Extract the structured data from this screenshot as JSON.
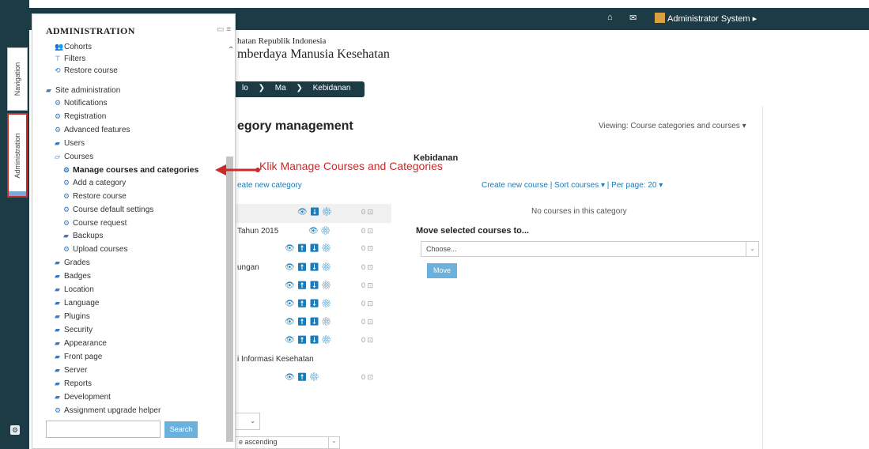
{
  "topbar": {
    "home_icon": "house-icon",
    "mail_icon": "message-icon",
    "user_name": "Administrator System ▸"
  },
  "dock": {
    "nav_label": "Navigation",
    "admin_label": "Administration"
  },
  "brand": {
    "line1": "hatan Republik Indonesia",
    "line2": "mberdaya Manusia Kesehatan"
  },
  "breadcrumb": [
    "lo",
    "Ma",
    "Kebidanan"
  ],
  "main": {
    "title": "egory management",
    "viewing": "Viewing:  Course categories and courses ▾",
    "create_category": "eate new category",
    "category_title": "Kebidanan",
    "links": "Create new course  |  Sort courses ▾  |  Per page: 20 ▾",
    "empty": "No courses in this category",
    "move_title": "Move selected courses to...",
    "choose": "Choose...",
    "move_btn": "Move",
    "small_select": "⌄",
    "sort_select": "e ascending",
    "categories": [
      {
        "name": "",
        "icons": "👁  ⬇  ⚙",
        "count": "0 ⊡"
      },
      {
        "name": "Tahun 2015",
        "icons": "👁     ⚙",
        "count": "0 ⊡"
      },
      {
        "name": "",
        "icons": "👁  ⬆  ⬇  ⚙",
        "count": "0 ⊡"
      },
      {
        "name": "ungan",
        "icons": "👁  ⬆  ⬇  ⚙",
        "count": "0 ⊡"
      },
      {
        "name": "",
        "icons": "👁  ⬆  ⬇  ⚙",
        "count": "0 ⊡"
      },
      {
        "name": "",
        "icons": "👁  ⬆  ⬇  ⚙",
        "count": "0 ⊡"
      },
      {
        "name": "",
        "icons": "👁  ⬆  ⬇  ⚙",
        "count": "0 ⊡"
      },
      {
        "name": "",
        "icons": "👁  ⬆  ⬇  ⚙",
        "count": "0 ⊡"
      },
      {
        "name": "i Informasi Kesehatan",
        "icons": "",
        "count": ""
      },
      {
        "name": "",
        "icons": "👁  ⬆     ⚙",
        "count": "0 ⊡"
      }
    ]
  },
  "admin_panel": {
    "title": "ADMINISTRATION",
    "items": [
      {
        "label": "Cohorts",
        "icon": "people-icon"
      },
      {
        "label": "Filters",
        "icon": "filter-icon"
      },
      {
        "label": "Restore course",
        "icon": "restore-icon"
      },
      {
        "label": "Site administration",
        "icon": "folder-open-icon"
      },
      {
        "label": "Notifications",
        "icon": "gear-icon"
      },
      {
        "label": "Registration",
        "icon": "gear-icon"
      },
      {
        "label": "Advanced features",
        "icon": "gear-icon"
      },
      {
        "label": "Users",
        "icon": "folder-icon"
      },
      {
        "label": "Courses",
        "icon": "folder-open-icon"
      },
      {
        "label": "Manage courses and categories",
        "icon": "gear-icon"
      },
      {
        "label": "Add a category",
        "icon": "gear-icon"
      },
      {
        "label": "Restore course",
        "icon": "gear-icon"
      },
      {
        "label": "Course default settings",
        "icon": "gear-icon"
      },
      {
        "label": "Course request",
        "icon": "gear-icon"
      },
      {
        "label": "Backups",
        "icon": "folder-icon"
      },
      {
        "label": "Upload courses",
        "icon": "gear-icon"
      },
      {
        "label": "Grades",
        "icon": "folder-icon"
      },
      {
        "label": "Badges",
        "icon": "folder-icon"
      },
      {
        "label": "Location",
        "icon": "folder-icon"
      },
      {
        "label": "Language",
        "icon": "folder-icon"
      },
      {
        "label": "Plugins",
        "icon": "folder-icon"
      },
      {
        "label": "Security",
        "icon": "folder-icon"
      },
      {
        "label": "Appearance",
        "icon": "folder-icon"
      },
      {
        "label": "Front page",
        "icon": "folder-icon"
      },
      {
        "label": "Server",
        "icon": "folder-icon"
      },
      {
        "label": "Reports",
        "icon": "folder-icon"
      },
      {
        "label": "Development",
        "icon": "folder-icon"
      },
      {
        "label": "Assignment upgrade helper",
        "icon": "gear-icon"
      }
    ],
    "search_btn": "Search"
  },
  "annotation": "Klik Manage Courses and Categories",
  "colors": {
    "topbar": "#1c3b45",
    "link": "#1a7cb8",
    "annotation": "#c72b2b",
    "button": "#6ab2dc"
  }
}
